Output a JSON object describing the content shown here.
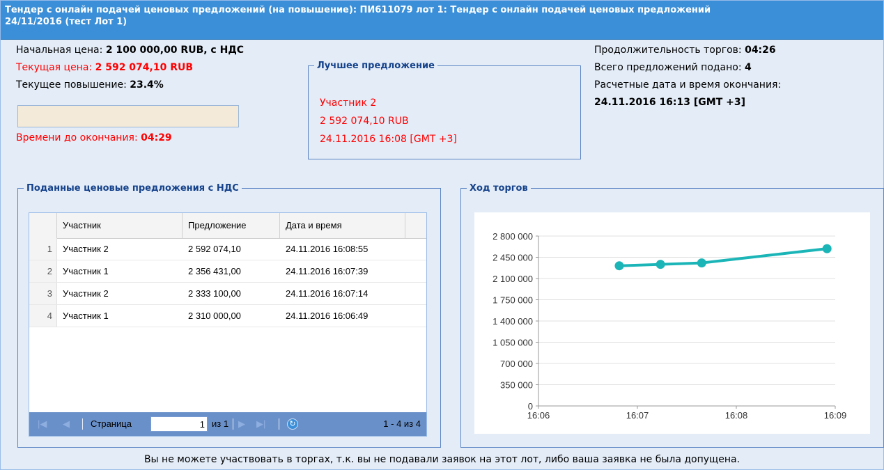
{
  "title": {
    "line1": "Тендер с онлайн подачей ценовых предложений (на повышение): ПИ611079 лот 1: Тендер с онлайн подачей ценовых предложений",
    "line2": "24/11/2016 (тест Лот 1)"
  },
  "info": {
    "start_price_label": "Начальная цена: ",
    "start_price_value": "2 100 000,00 RUB, с НДС",
    "current_price_label": "Текущая цена: ",
    "current_price_value": "2 592 074,10 RUB",
    "increase_label": "Текущее повышение: ",
    "increase_value": "23.4%",
    "progress_fraction": 0.0,
    "time_left_label": "Времени до окончания: ",
    "time_left_value": "04:29"
  },
  "best_offer": {
    "legend": "Лучшее предложение",
    "participant": "Участник 2",
    "amount": "2 592 074,10 RUB",
    "datetime": "24.11.2016 16:08 [GMT +3]"
  },
  "stats": {
    "duration_label": "Продолжительность торгов: ",
    "duration_value": "04:26",
    "total_label": "Всего предложений подано: ",
    "total_value": "4",
    "end_label": "Расчетные дата и время окончания:",
    "end_value": "24.11.2016 16:13 [GMT +3]"
  },
  "offers": {
    "legend": "Поданные ценовые предложения с НДС",
    "columns": [
      "Участник",
      "Предложение",
      "Дата и время"
    ],
    "rows": [
      {
        "num": "1",
        "participant": "Участник 2",
        "amount": "2 592 074,10",
        "datetime": "24.11.2016 16:08:55"
      },
      {
        "num": "2",
        "participant": "Участник 1",
        "amount": "2 356 431,00",
        "datetime": "24.11.2016 16:07:39"
      },
      {
        "num": "3",
        "participant": "Участник 2",
        "amount": "2 333 100,00",
        "datetime": "24.11.2016 16:07:14"
      },
      {
        "num": "4",
        "participant": "Участник 1",
        "amount": "2 310 000,00",
        "datetime": "24.11.2016 16:06:49"
      }
    ],
    "pager": {
      "page_label": "Страница",
      "page_value": "1",
      "of_label": "из 1",
      "summary": "1 - 4 из 4"
    }
  },
  "chart_legend": "Ход торгов",
  "chart_data": {
    "type": "line",
    "x": [
      "16:06:49",
      "16:07:14",
      "16:07:39",
      "16:08:55"
    ],
    "values": [
      2310000,
      2333100,
      2356431,
      2592074.1
    ],
    "xticks": [
      "16:06",
      "16:07",
      "16:08",
      "16:09"
    ],
    "yticks": [
      "2 800 000",
      "2 450 000",
      "2 100 000",
      "1 750 000",
      "1 400 000",
      "1 050 000",
      "700 000",
      "350 000",
      "0"
    ],
    "ylim": [
      0,
      2800000
    ],
    "xlim": [
      "16:06",
      "16:09"
    ],
    "grid": true,
    "color": "#1bb5b8"
  },
  "footer": "Вы не можете участвовать в торгах, т.к. вы не подавали заявок на этот лот, либо ваша заявка не была допущена."
}
